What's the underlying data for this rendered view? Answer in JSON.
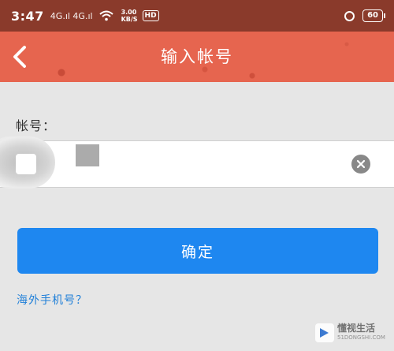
{
  "status_bar": {
    "time": "3:47",
    "signal": "4G.ıl 4G.ıl",
    "speed_value": "3.00",
    "speed_unit": "KB/S",
    "hd": "HD",
    "battery": "60"
  },
  "header": {
    "title": "输入帐号",
    "back_icon": "chevron-left-icon"
  },
  "form": {
    "account_label": "帐号：",
    "account_value": "",
    "clear_icon": "close-circle-icon"
  },
  "actions": {
    "confirm_label": "确定",
    "overseas_link": "海外手机号？"
  },
  "watermark": {
    "name": "懂视生活",
    "url": "51DONGSHI.COM"
  },
  "colors": {
    "status_bar": "#8a3a2b",
    "nav_bar": "#e6654f",
    "primary": "#1e87f0",
    "link": "#1f7fd8",
    "background": "#e6e6e6"
  }
}
